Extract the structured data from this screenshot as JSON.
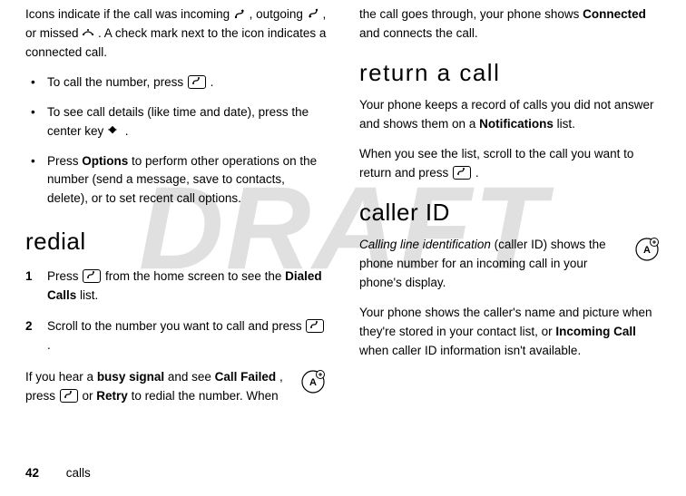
{
  "watermark": "DRAFT",
  "left": {
    "intro_a": "Icons indicate if the call was incoming ",
    "intro_b": ", outgoing ",
    "intro_c": ", or missed ",
    "intro_d": ". A check mark next to the icon indicates a connected call.",
    "bullets": {
      "b1a": "To call the number, press ",
      "b1b": ".",
      "b2a": "To see call details (like time and date), press the center key ",
      "b2b": ".",
      "b3a": "Press ",
      "b3_options": "Options",
      "b3b": " to perform other operations on the number (send a message, save to contacts, delete), or to set recent call options."
    },
    "redial_heading": "redial",
    "steps": {
      "n1": "1",
      "s1a": "Press ",
      "s1b": " from the home screen to see the ",
      "s1_dialed": "Dialed Calls",
      "s1c": " list.",
      "n2": "2",
      "s2a": "Scroll to the number you want to call and press ",
      "s2b": "."
    },
    "busy_a": "If you hear a ",
    "busy_signal": "busy signal",
    "busy_b": " and see ",
    "call_failed": "Call Failed",
    "busy_c": ", press ",
    "busy_d": " or ",
    "retry": "Retry",
    "busy_e": " to redial the number. When "
  },
  "right": {
    "cont_a": "the call goes through, your phone shows ",
    "connected": "Connected",
    "cont_b": " and connects the call.",
    "return_heading": "return a call",
    "ret_a": "Your phone keeps a record of calls you did not answer and shows them on a ",
    "notifications": "Notifications",
    "ret_b": " list.",
    "ret_c": "When you see the list, scroll to the call you want to return and press ",
    "ret_d": ".",
    "callerid_heading": "caller ID",
    "cid_term": "Calling line identification",
    "cid_a": " (caller ID) shows the phone number for an incoming call in your phone's display.",
    "cid_b": "Your phone shows the caller's name and picture when they're stored in your contact list, or ",
    "incoming_call": "Incoming Call",
    "cid_c": " when caller ID information isn't available."
  },
  "footer": {
    "page": "42",
    "section": "calls"
  },
  "icons": {
    "incoming": "incoming-call-icon",
    "outgoing": "outgoing-call-icon",
    "missed": "missed-call-icon",
    "send_key": "send-key-icon",
    "center_key": "center-key-icon",
    "feature_badge": "feature-availability-badge"
  }
}
